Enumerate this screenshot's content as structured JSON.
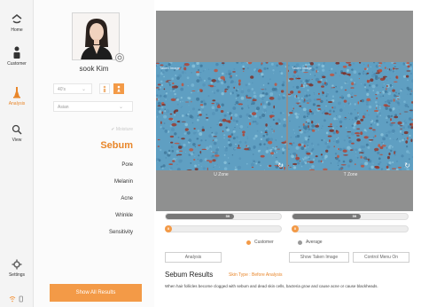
{
  "nav": {
    "items": [
      {
        "label": "Home",
        "icon": "home-icon"
      },
      {
        "label": "Customer",
        "icon": "customer-icon"
      },
      {
        "label": "Analysis",
        "icon": "analysis-icon"
      },
      {
        "label": "View",
        "icon": "search-icon"
      },
      {
        "label": "Settings",
        "icon": "gear-icon"
      }
    ],
    "active": "Analysis"
  },
  "customer": {
    "name": "sook Kim",
    "age": "40's",
    "race": "Asian"
  },
  "menu": {
    "moisture": "Moisture",
    "sebum": "Sebum",
    "pore": "Pore",
    "melanin": "Melanin",
    "acne": "Acne",
    "wrinkle": "Wrinkle",
    "sensitivity": "Sensitivity"
  },
  "show_all_label": "Show All Results",
  "images": {
    "left_tag": "Taken Image",
    "right_tag": "Taken Image",
    "left_zone": "U Zone",
    "right_zone": "T Zone"
  },
  "bars": {
    "u_average": 59,
    "u_customer": 0,
    "t_average": 59,
    "t_customer": 0
  },
  "legend": {
    "customer": "Customer",
    "average": "Average"
  },
  "buttons": {
    "analysis": "Analysis",
    "show_taken": "Show Taken Image",
    "control_menu": "Control Menu On"
  },
  "results": {
    "title": "Sebum Results",
    "subtitle": "Skin Type : Before Analysis",
    "description": "When hair follicles become clogged with sebum and dead skin cells, bacteria grow and cause acne or cause blackheads."
  },
  "colors": {
    "accent": "#f39a47",
    "bar_fill": "#777777",
    "image_bg": "#8f9090"
  }
}
